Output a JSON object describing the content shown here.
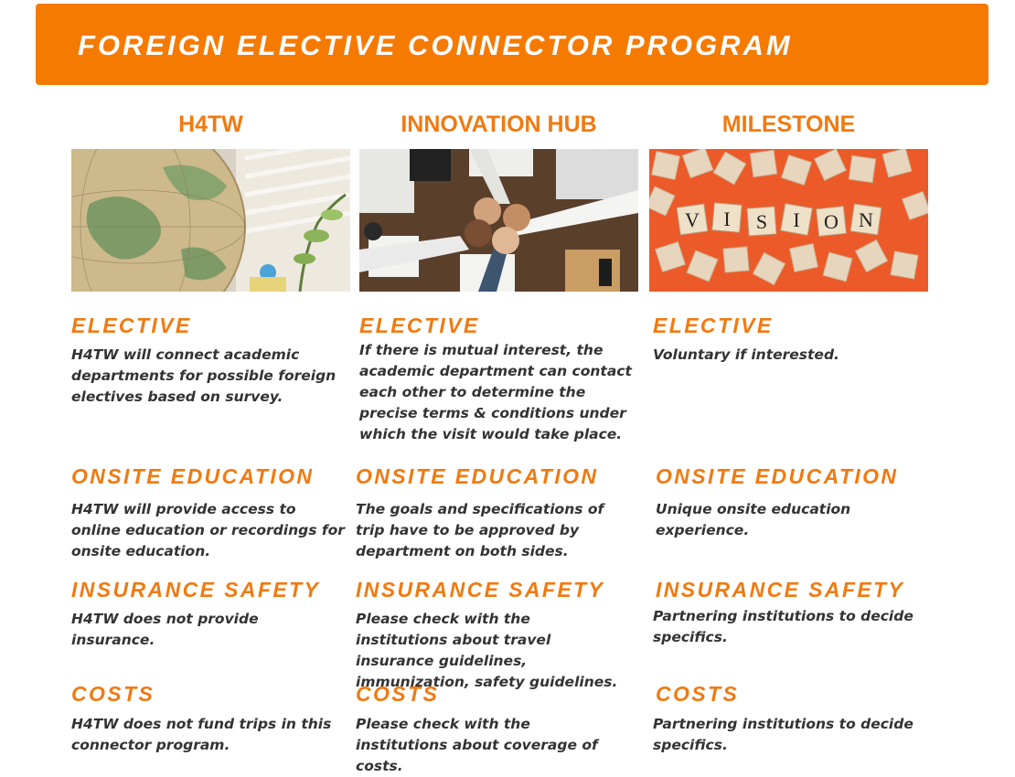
{
  "banner": {
    "title": "FOREIGN ELECTIVE CONNECTOR PROGRAM"
  },
  "colors": {
    "brand_orange": "#f57a02",
    "heading_orange": "#f07a10",
    "body_text": "#333333"
  },
  "columns": [
    {
      "title": "H4TW",
      "image": "globe-photo",
      "sections": [
        {
          "heading": "ELECTIVE",
          "text": "H4TW will connect academic departments for possible foreign electives based on survey."
        },
        {
          "heading": "ONSITE EDUCATION",
          "text": "H4TW will provide access to online education or recordings for onsite education."
        },
        {
          "heading": "INSURANCE SAFETY",
          "text": "H4TW does not provide insurance."
        },
        {
          "heading": "COSTS",
          "text": "H4TW does not fund trips in this connector program."
        }
      ]
    },
    {
      "title": "INNOVATION HUB",
      "image": "fist-bump-photo",
      "sections": [
        {
          "heading": "ELECTIVE",
          "text": "If there is mutual interest, the academic department can contact each other to determine the precise terms & conditions under which the visit would take place."
        },
        {
          "heading": "ONSITE EDUCATION",
          "text": "The goals and specifications of trip have to be approved by department on both sides."
        },
        {
          "heading": "INSURANCE SAFETY",
          "text": "Please check with the institutions about travel insurance guidelines, immunization, safety guidelines."
        },
        {
          "heading": "COSTS",
          "text": "Please check with the institutions about coverage of costs."
        }
      ]
    },
    {
      "title": "MILESTONE",
      "image": "vision-tiles-photo",
      "image_text": "VISION",
      "sections": [
        {
          "heading": "ELECTIVE",
          "text": "Voluntary if interested."
        },
        {
          "heading": "ONSITE EDUCATION",
          "text": "Unique onsite education experience."
        },
        {
          "heading": "INSURANCE SAFETY",
          "text": "Partnering institutions to decide specifics."
        },
        {
          "heading": "COSTS",
          "text": "Partnering institutions to decide specifics."
        }
      ]
    }
  ]
}
